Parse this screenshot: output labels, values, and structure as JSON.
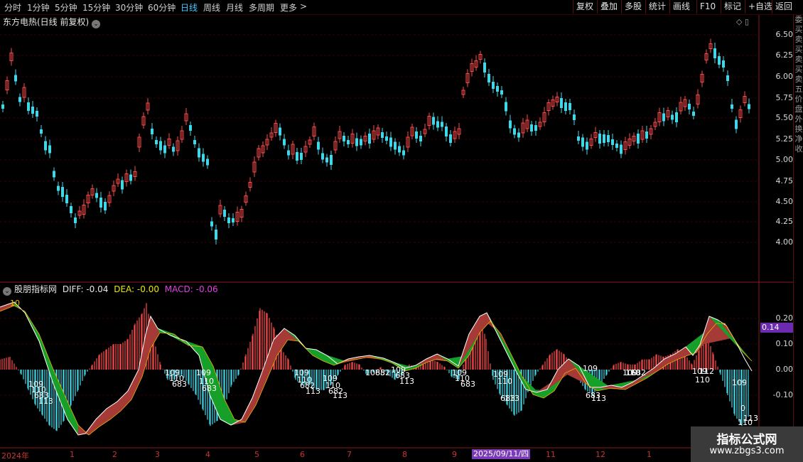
{
  "periods": [
    {
      "label": "分时",
      "active": false
    },
    {
      "label": "1分钟",
      "active": false
    },
    {
      "label": "5分钟",
      "active": false
    },
    {
      "label": "15分钟",
      "active": false
    },
    {
      "label": "30分钟",
      "active": false
    },
    {
      "label": "60分钟",
      "active": false
    },
    {
      "label": "日线",
      "active": true
    },
    {
      "label": "周线",
      "active": false
    },
    {
      "label": "月线",
      "active": false
    },
    {
      "label": "多周期",
      "active": false
    },
    {
      "label": "更多",
      "active": false
    }
  ],
  "more_arrow": ">",
  "tools": [
    "复权",
    "叠加",
    "多股",
    "统计",
    "画线",
    "F10",
    "标记",
    "+自选",
    "返回"
  ],
  "main": {
    "title": "东方电热(日线 前复权)",
    "chevron": "⌄",
    "corner_icons": "◇ ▯",
    "yticks": [
      "6.50",
      "6.25",
      "6.00",
      "5.75",
      "5.50",
      "5.25",
      "5.00",
      "4.75",
      "4.50",
      "4.25",
      "4.00"
    ]
  },
  "indicator": {
    "name": "股朋指标网",
    "diff_label": "DIFF: -0.04",
    "dea_label": "DEA: -0.00",
    "macd_label": "MACD: -0.06",
    "yticks": [
      "0.20",
      "0.10",
      "0.00",
      "-0.10"
    ],
    "current_value": "0.14",
    "diff_color": "#e6e6e6",
    "dea_color": "#e8e800",
    "macd_color": "#e040e0"
  },
  "annotations": [
    {
      "t": "10",
      "x": 14,
      "y": 430,
      "c": "#e6c000"
    },
    {
      "t": "109",
      "x": 40,
      "y": 544
    },
    {
      "t": "110",
      "x": 44,
      "y": 552
    },
    {
      "t": "683",
      "x": 48,
      "y": 560
    },
    {
      "t": "113",
      "x": 54,
      "y": 568
    },
    {
      "t": "109",
      "x": 232,
      "y": 528
    },
    {
      "t": "110",
      "x": 238,
      "y": 536
    },
    {
      "t": "683",
      "x": 242,
      "y": 544
    },
    {
      "t": "109",
      "x": 276,
      "y": 528
    },
    {
      "t": "110",
      "x": 280,
      "y": 540
    },
    {
      "t": "683",
      "x": 284,
      "y": 550
    },
    {
      "t": "109",
      "x": 414,
      "y": 528
    },
    {
      "t": "110",
      "x": 418,
      "y": 538
    },
    {
      "t": "682",
      "x": 422,
      "y": 546
    },
    {
      "t": "113",
      "x": 430,
      "y": 554
    },
    {
      "t": "109",
      "x": 454,
      "y": 536
    },
    {
      "t": "110",
      "x": 458,
      "y": 546
    },
    {
      "t": "682",
      "x": 462,
      "y": 554
    },
    {
      "t": "113",
      "x": 468,
      "y": 560
    },
    {
      "t": "1085",
      "x": 514,
      "y": 528
    },
    {
      "t": "682",
      "x": 528,
      "y": 528
    },
    {
      "t": "109",
      "x": 550,
      "y": 524
    },
    {
      "t": "683",
      "x": 556,
      "y": 532
    },
    {
      "t": "113",
      "x": 562,
      "y": 540
    },
    {
      "t": "109",
      "x": 636,
      "y": 528
    },
    {
      "t": "110",
      "x": 640,
      "y": 536
    },
    {
      "t": "683",
      "x": 648,
      "y": 544
    },
    {
      "t": "109",
      "x": 694,
      "y": 530
    },
    {
      "t": "110",
      "x": 700,
      "y": 540
    },
    {
      "t": "683",
      "x": 704,
      "y": 564
    },
    {
      "t": "113",
      "x": 710,
      "y": 564
    },
    {
      "t": "109",
      "x": 820,
      "y": 522
    },
    {
      "t": "683",
      "x": 824,
      "y": 560
    },
    {
      "t": "113",
      "x": 832,
      "y": 564
    },
    {
      "t": "109",
      "x": 876,
      "y": 528
    },
    {
      "t": "110",
      "x": 880,
      "y": 528
    },
    {
      "t": "682",
      "x": 888,
      "y": 528
    },
    {
      "t": "109",
      "x": 974,
      "y": 526
    },
    {
      "t": "112",
      "x": 984,
      "y": 526
    },
    {
      "t": "110",
      "x": 978,
      "y": 538
    },
    {
      "t": "109",
      "x": 1030,
      "y": 542
    },
    {
      "t": "0",
      "x": 1042,
      "y": 578
    },
    {
      "t": "113",
      "x": 1046,
      "y": 592
    },
    {
      "t": "110",
      "x": 1038,
      "y": 598
    }
  ],
  "xaxis": {
    "labels": [
      "2024年",
      "1",
      "2",
      "3",
      "4",
      "5",
      "6",
      "7",
      "8",
      "9",
      "11",
      "12",
      "1"
    ],
    "selected_date": "2025/09/11/四"
  },
  "right_strip": [
    "委",
    "买",
    "卖",
    "买",
    "卖",
    "买",
    "卖",
    "五",
    "价",
    "盘",
    "外",
    "换",
    "净",
    "收"
  ],
  "watermark": {
    "line1": "指标公式网",
    "line2": "www.zbgs3.com"
  },
  "colors": {
    "up": "#ff4a4a",
    "down": "#40d8e8",
    "band_up": "#a53a36",
    "band_down": "#16a02a"
  }
}
